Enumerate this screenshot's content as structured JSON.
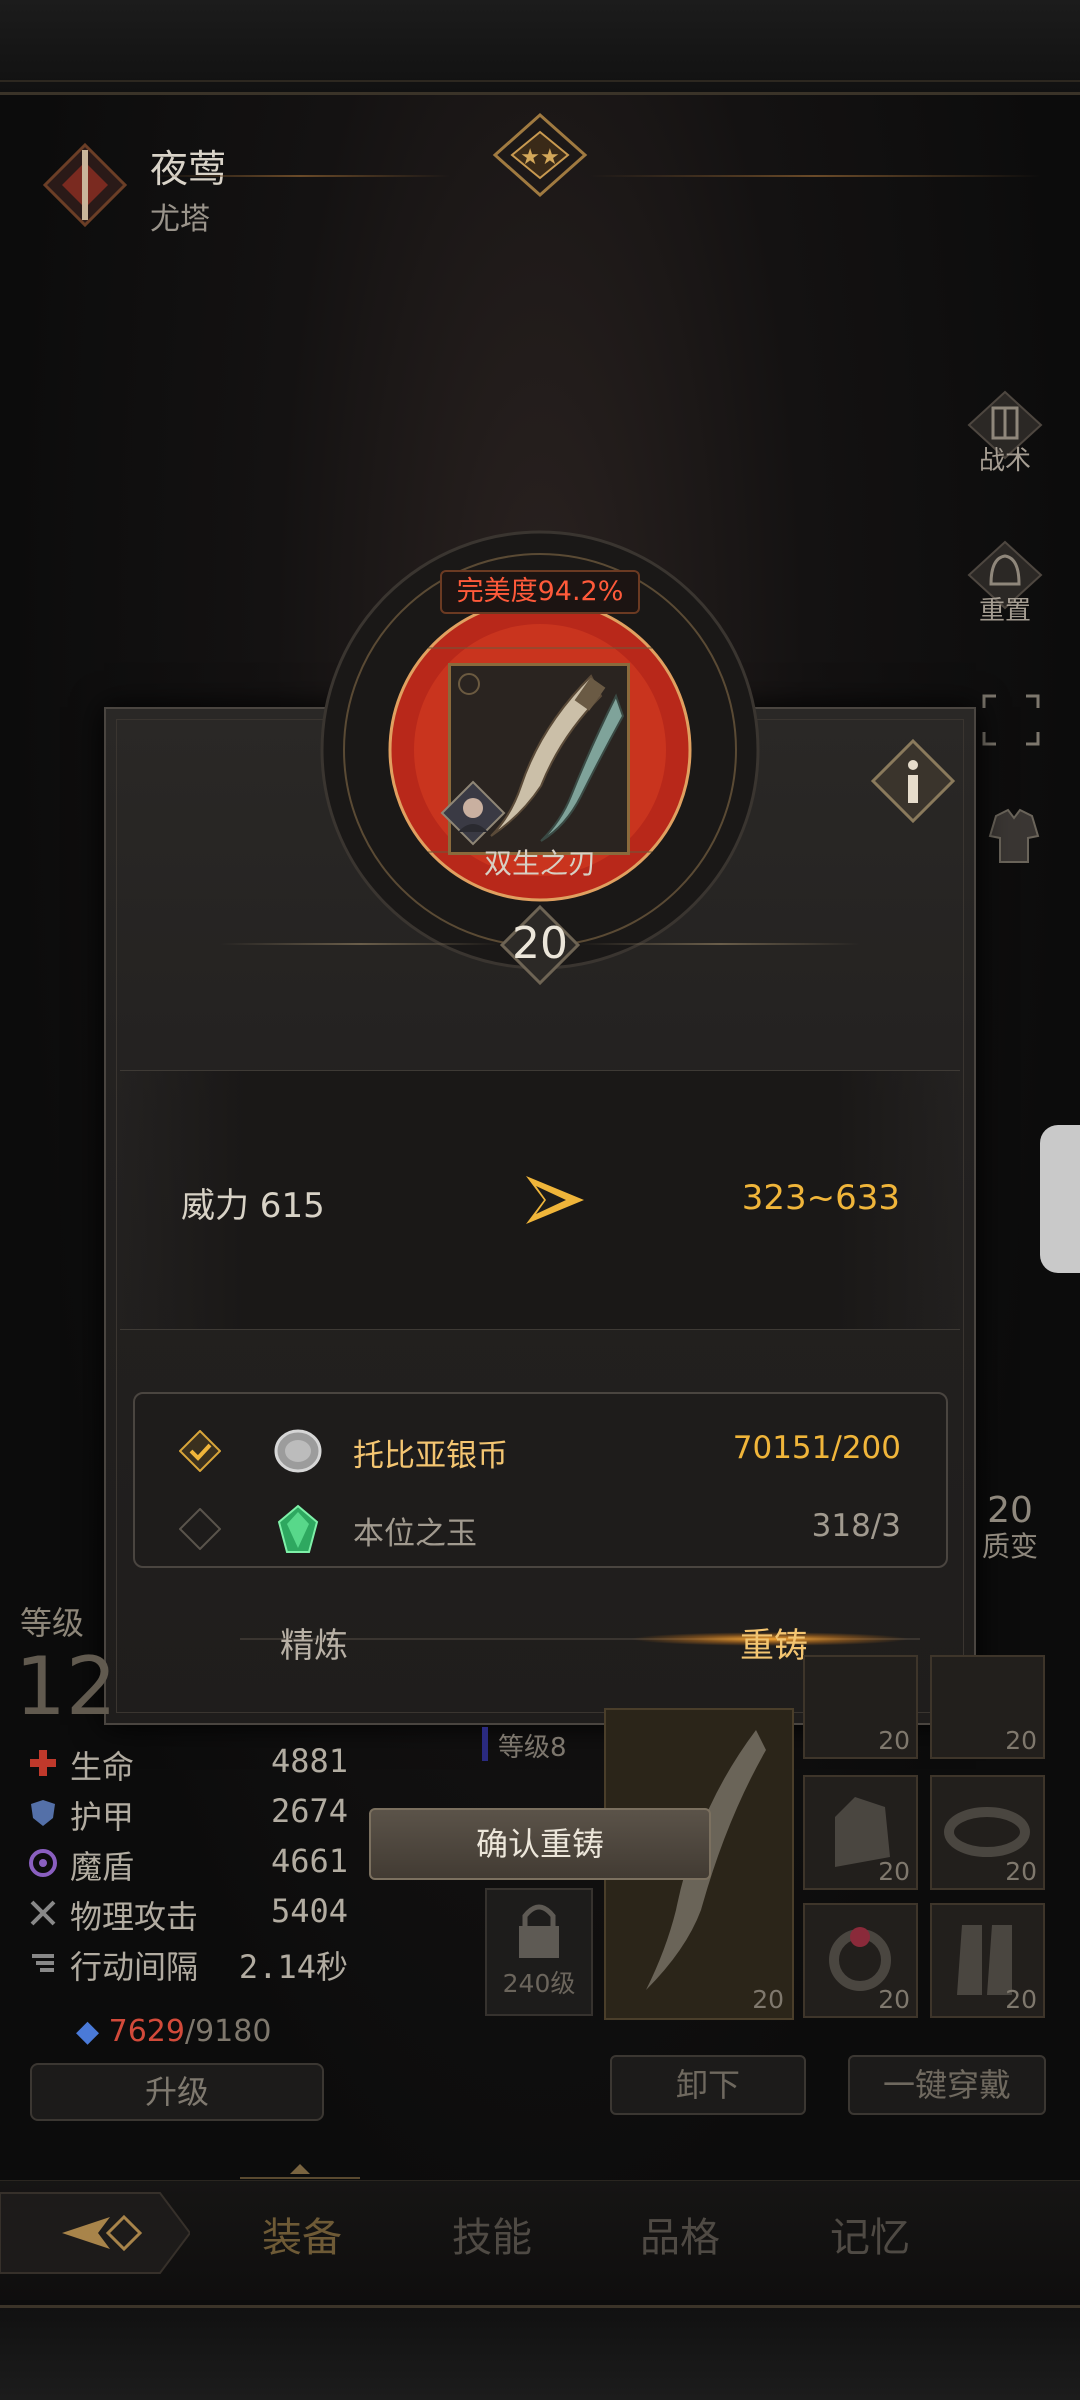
{
  "header": {
    "name": "夜莺",
    "subtitle": "尤塔"
  },
  "side_menu": [
    {
      "label": "战术",
      "icon": "tactics-icon"
    },
    {
      "label": "重置",
      "icon": "reset-helmet-icon"
    }
  ],
  "item": {
    "perfection": "完美度94.2%",
    "name": "双生之刃",
    "level": "20"
  },
  "stat": {
    "left": "威力 615",
    "right": "323~633"
  },
  "costs": [
    {
      "name": "托比亚银币",
      "value": "70151/200",
      "checked": true,
      "icon": "silver-coin-icon"
    },
    {
      "name": "本位之玉",
      "value": "318/3",
      "checked": false,
      "icon": "green-gem-icon"
    }
  ],
  "tabs": {
    "refine": "精炼",
    "reforge": "重铸"
  },
  "confirm_label": "确认重铸",
  "character": {
    "grade_label": "等级",
    "grade_value": "12",
    "stats": [
      {
        "name": "生命",
        "value": "4881",
        "icon": "life-cross-icon",
        "color": "#c0392b"
      },
      {
        "name": "护甲",
        "value": "2674",
        "icon": "armor-shield-icon",
        "color": "#5470a8"
      },
      {
        "name": "魔盾",
        "value": "4661",
        "icon": "magic-shield-icon",
        "color": "#8a5fc0"
      },
      {
        "name": "物理攻击",
        "value": "5404",
        "icon": "crossed-swords-icon",
        "color": "#888"
      },
      {
        "name": "行动间隔",
        "value": "2.14秒",
        "icon": "speed-wing-icon",
        "color": "#888"
      }
    ],
    "mana_current": "7629",
    "mana_max": "/9180",
    "upgrade_label": "升级"
  },
  "equipment": {
    "level8_label": "等级8",
    "locked_label": "240级",
    "main_slot_level": "20",
    "slots": [
      "20",
      "20",
      "20",
      "20",
      "20",
      "20",
      "20"
    ]
  },
  "transform": {
    "value": "20",
    "label": "质变"
  },
  "buttons": {
    "unequip": "卸下",
    "equip_all": "一键穿戴"
  },
  "nav": [
    "装备",
    "技能",
    "品格",
    "记忆"
  ],
  "colors": {
    "accent": "#f0b53a",
    "highlight": "#f3c571",
    "danger": "#ff5a3a"
  }
}
